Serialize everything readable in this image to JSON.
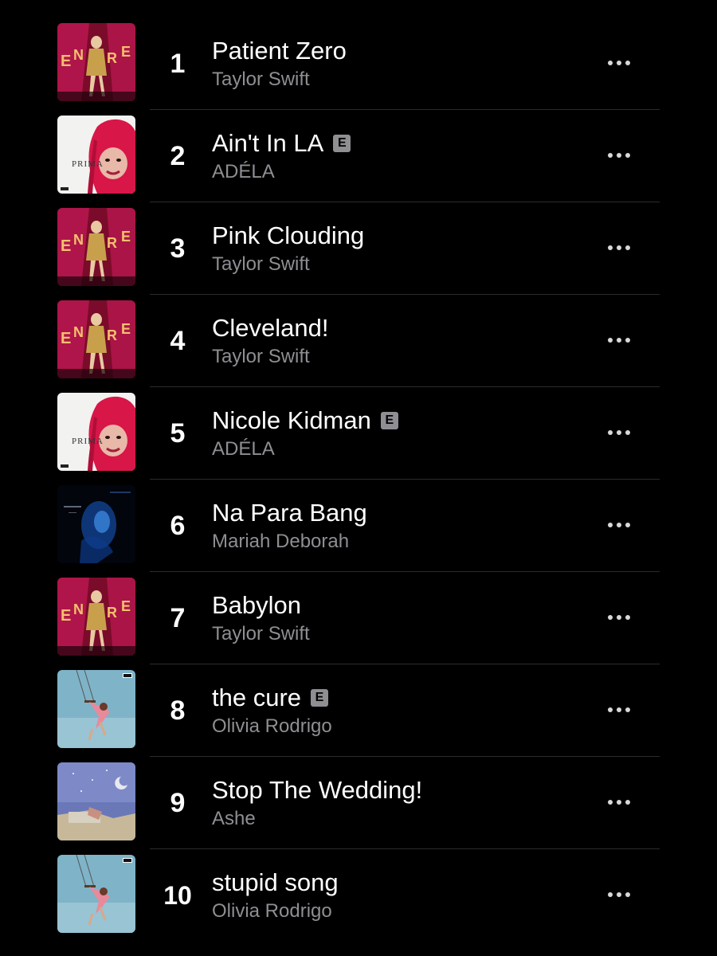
{
  "tracks": [
    {
      "rank": "1",
      "title": "Patient Zero",
      "artist": "Taylor Swift",
      "explicit": false,
      "art": "encore"
    },
    {
      "rank": "2",
      "title": "Ain't In LA",
      "artist": "ADÉLA",
      "explicit": true,
      "art": "prima"
    },
    {
      "rank": "3",
      "title": "Pink Clouding",
      "artist": "Taylor Swift",
      "explicit": false,
      "art": "encore"
    },
    {
      "rank": "4",
      "title": "Cleveland!",
      "artist": "Taylor Swift",
      "explicit": false,
      "art": "encore"
    },
    {
      "rank": "5",
      "title": "Nicole Kidman",
      "artist": "ADÉLA",
      "explicit": true,
      "art": "prima"
    },
    {
      "rank": "6",
      "title": "Na Para Bang",
      "artist": "Mariah Deborah",
      "explicit": false,
      "art": "blue"
    },
    {
      "rank": "7",
      "title": "Babylon",
      "artist": "Taylor Swift",
      "explicit": false,
      "art": "encore"
    },
    {
      "rank": "8",
      "title": "the cure",
      "artist": "Olivia Rodrigo",
      "explicit": true,
      "art": "swing"
    },
    {
      "rank": "9",
      "title": "Stop The Wedding!",
      "artist": "Ashe",
      "explicit": false,
      "art": "sky"
    },
    {
      "rank": "10",
      "title": "stupid song",
      "artist": "Olivia Rodrigo",
      "explicit": false,
      "art": "swing"
    }
  ],
  "explicit_badge": "E",
  "colors": {
    "background": "#000000",
    "title": "#ffffff",
    "artist": "#8e8e93",
    "separator": "#2c2c2e",
    "badge": "#8e8e93"
  },
  "icons": {
    "more": "more-options-icon",
    "explicit": "explicit-icon"
  }
}
